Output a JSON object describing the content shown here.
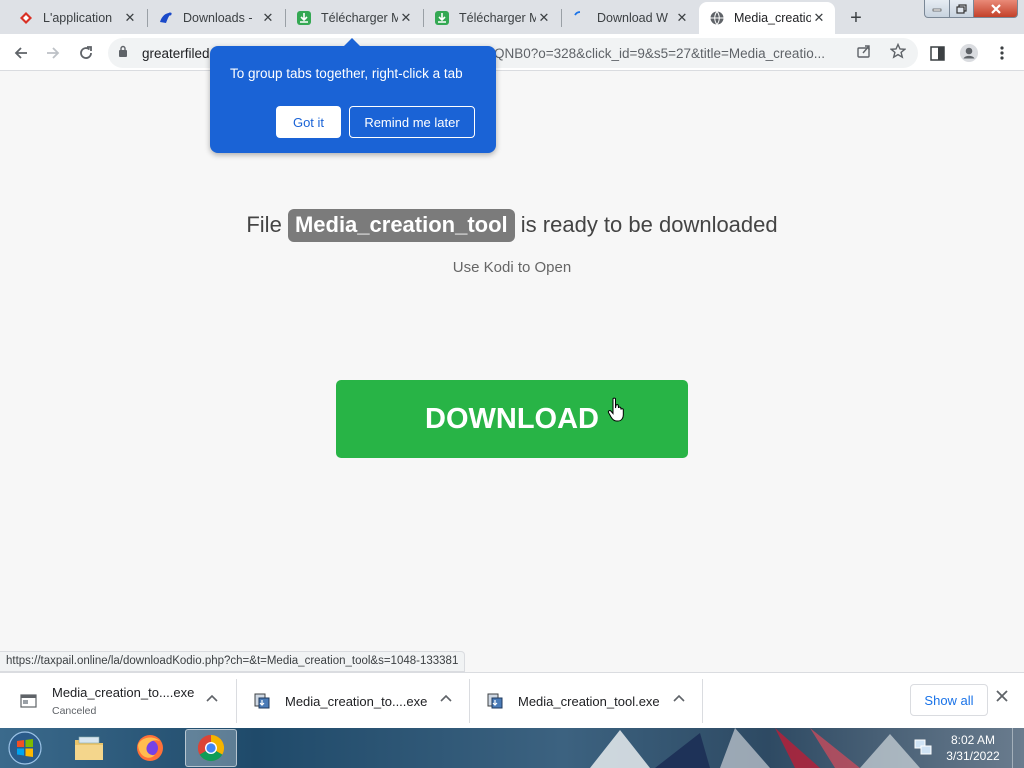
{
  "tabs": [
    {
      "title": "L'application",
      "favicon": "red-diamond-icon"
    },
    {
      "title": "Downloads -",
      "favicon": "blue-bird-icon"
    },
    {
      "title": "Télécharger M",
      "favicon": "green-download-icon"
    },
    {
      "title": "Télécharger M",
      "favicon": "green-download-icon"
    },
    {
      "title": "Download W",
      "favicon": "loading-icon"
    },
    {
      "title": "Media_creatio",
      "favicon": "globe-icon",
      "active": true
    }
  ],
  "toolbar": {
    "url_domain": "greaterfiled",
    "url_rest": "QNB0?o=328&click_id=9&s5=27&title=Media_creatio..."
  },
  "tip": {
    "text": "To group tabs together, right-click a tab",
    "got_it": "Got it",
    "remind": "Remind me later"
  },
  "main": {
    "prefix": "File",
    "filename": "Media_creation_tool",
    "suffix": "is ready to be downloaded",
    "subtitle": "Use Kodi to Open",
    "download_label": "DOWNLOAD"
  },
  "status_url": "https://taxpail.online/la/downloadKodio.php?ch=&t=Media_creation_tool&s=1048-133381",
  "downloads": [
    {
      "name": "Media_creation_to....exe",
      "status": "Canceled"
    },
    {
      "name": "Media_creation_to....exe"
    },
    {
      "name": "Media_creation_tool.exe"
    }
  ],
  "shelf": {
    "show_all": "Show all"
  },
  "clock": {
    "time": "8:02 AM",
    "date": "3/31/2022"
  },
  "colors": {
    "download_button": "#28b446",
    "tip_background": "#1a63d6",
    "filename_pill": "#7b7b7b"
  }
}
